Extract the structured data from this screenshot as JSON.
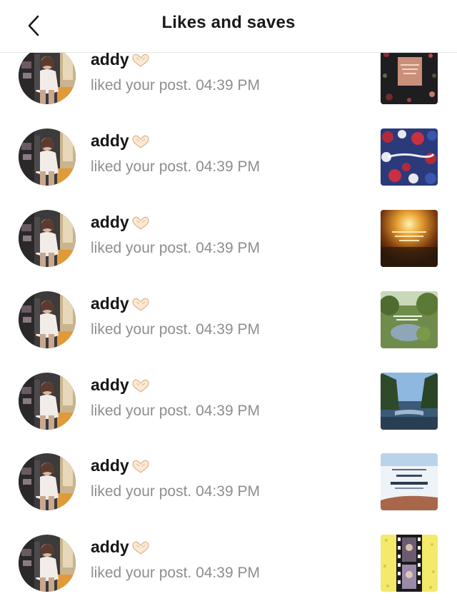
{
  "header": {
    "title": "Likes and saves",
    "back_icon": "chevron-left-icon"
  },
  "colors": {
    "text_primary": "#161616",
    "text_secondary": "#8e8e8e",
    "divider": "#e6e6e6"
  },
  "notifications": [
    {
      "username": "addy",
      "username_emoji": "heart-hands-icon",
      "action": "liked your post. 04:39 PM",
      "thumbnail": "dark-floral-card"
    },
    {
      "username": "addy",
      "username_emoji": "heart-hands-icon",
      "action": "liked your post. 04:39 PM",
      "thumbnail": "fireworks-fourth-of-july"
    },
    {
      "username": "addy",
      "username_emoji": "heart-hands-icon",
      "action": "liked your post. 04:39 PM",
      "thumbnail": "sunset-quote"
    },
    {
      "username": "addy",
      "username_emoji": "heart-hands-icon",
      "action": "liked your post. 04:39 PM",
      "thumbnail": "green-pond-quote"
    },
    {
      "username": "addy",
      "username_emoji": "heart-hands-icon",
      "action": "liked your post. 04:39 PM",
      "thumbnail": "lake-forest"
    },
    {
      "username": "addy",
      "username_emoji": "heart-hands-icon",
      "action": "liked your post. 04:39 PM",
      "thumbnail": "poster-card"
    },
    {
      "username": "addy",
      "username_emoji": "heart-hands-icon",
      "action": "liked your post. 04:39 PM",
      "thumbnail": "film-strip-yellow"
    }
  ]
}
